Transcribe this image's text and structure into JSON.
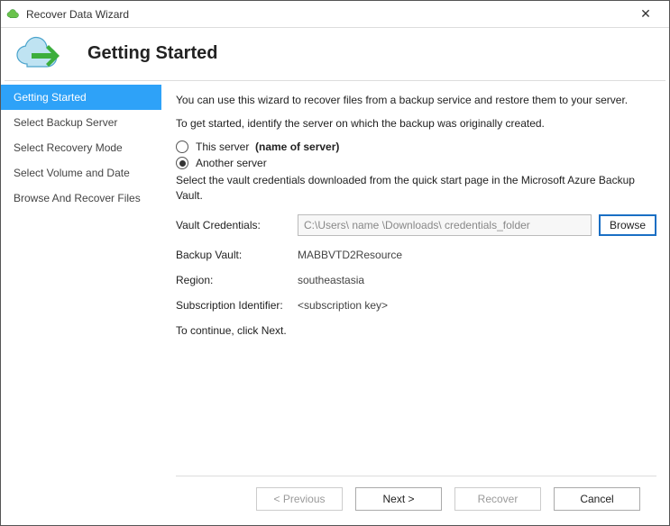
{
  "window": {
    "title": "Recover Data Wizard"
  },
  "header": {
    "title": "Getting Started"
  },
  "sidebar": {
    "steps": [
      "Getting Started",
      "Select Backup Server",
      "Select Recovery Mode",
      "Select Volume and Date",
      "Browse And Recover Files"
    ]
  },
  "content": {
    "intro1": "You can use this wizard to recover files from a backup service and restore them to your server.",
    "intro2": "To get started, identify the server on which the backup was originally created.",
    "radio": {
      "this_server": "This server",
      "server_name": "(name of server)",
      "another_server": "Another server"
    },
    "vault_instruction": "Select the vault credentials downloaded from the quick start page in the Microsoft Azure Backup Vault.",
    "fields": {
      "vault_credentials_label": "Vault Credentials:",
      "vault_credentials_value": "C:\\Users\\ name \\Downloads\\ credentials_folder",
      "browse": "Browse",
      "backup_vault_label": "Backup Vault:",
      "backup_vault_value": "MABBVTD2Resource",
      "region_label": "Region:",
      "region_value": "southeastasia",
      "subscription_label": "Subscription Identifier:",
      "subscription_value": "<subscription key>"
    },
    "continue_note": "To continue, click Next."
  },
  "footer": {
    "previous": "< Previous",
    "next": "Next >",
    "recover": "Recover",
    "cancel": "Cancel"
  }
}
